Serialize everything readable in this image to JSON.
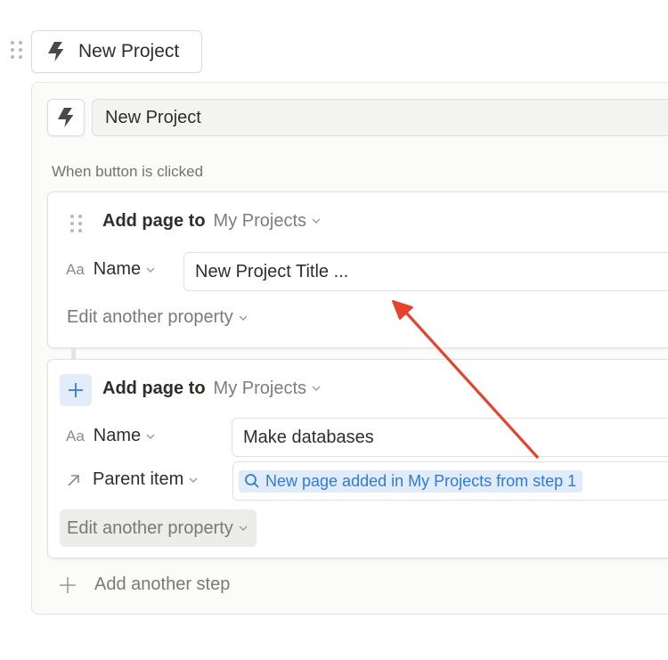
{
  "button_block": {
    "label": "New Project",
    "icon": "lightning-bolt-icon"
  },
  "editor": {
    "button_name": "New Project",
    "trigger_label": "When button is clicked",
    "steps": [
      {
        "action": "Add page to",
        "database": "My Projects",
        "properties": [
          {
            "icon": "Aa",
            "name": "Name",
            "value": "New Project Title ..."
          }
        ],
        "edit_another": "Edit another property"
      },
      {
        "action": "Add page to",
        "database": "My Projects",
        "properties": [
          {
            "icon": "Aa",
            "name": "Name",
            "value": "Make databases"
          },
          {
            "icon": "arrow-up-right-icon",
            "name": "Parent item",
            "value": "New page added in My Projects from step 1"
          }
        ],
        "edit_another": "Edit another property"
      }
    ],
    "add_step_label": "Add another step"
  },
  "annotation": {
    "color": "#e5432d",
    "type": "arrow"
  },
  "colors": {
    "accent_blue": "#2f7bd6",
    "chip_bg": "#e1ecfa"
  }
}
